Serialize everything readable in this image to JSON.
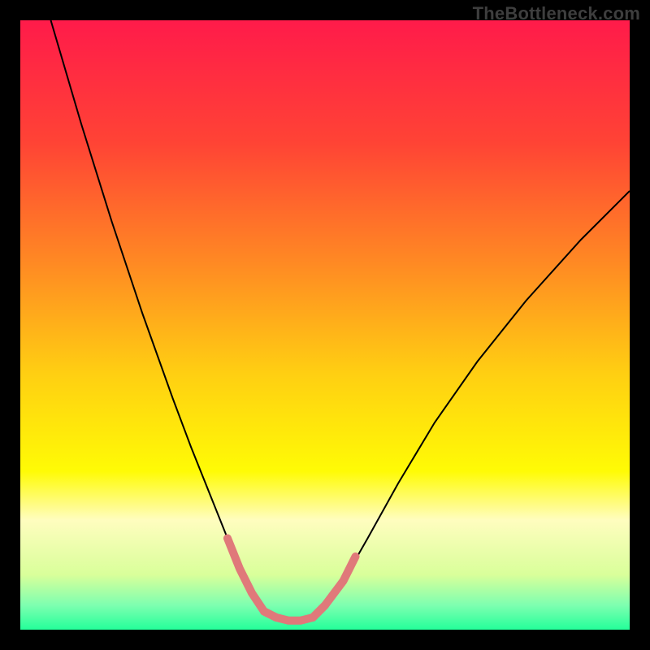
{
  "watermark": "TheBottleneck.com",
  "chart_data": {
    "type": "line",
    "title": "",
    "xlabel": "",
    "ylabel": "",
    "xlim": [
      0,
      100
    ],
    "ylim": [
      0,
      100
    ],
    "grid": false,
    "legend": false,
    "annotations": [],
    "background_gradient_stops": [
      {
        "pct": 0,
        "color": "#ff1b4a"
      },
      {
        "pct": 20,
        "color": "#ff4335"
      },
      {
        "pct": 40,
        "color": "#ff8a23"
      },
      {
        "pct": 58,
        "color": "#ffcf12"
      },
      {
        "pct": 74,
        "color": "#fffb05"
      },
      {
        "pct": 82,
        "color": "#fffdbf"
      },
      {
        "pct": 91,
        "color": "#d9ff9a"
      },
      {
        "pct": 96,
        "color": "#7dffb0"
      },
      {
        "pct": 100,
        "color": "#24ff9a"
      }
    ],
    "series": [
      {
        "name": "left-curve",
        "role": "bottleneck-curve",
        "stroke": "#000000",
        "stroke_width": 2,
        "x": [
          5,
          10,
          15,
          20,
          25,
          28,
          30,
          32,
          34,
          36,
          38,
          40,
          42
        ],
        "y": [
          100,
          83,
          67,
          52,
          38,
          30,
          25,
          20,
          15,
          10,
          6,
          3,
          2
        ]
      },
      {
        "name": "right-curve",
        "role": "bottleneck-curve",
        "stroke": "#000000",
        "stroke_width": 2,
        "x": [
          48,
          50,
          53,
          57,
          62,
          68,
          75,
          83,
          92,
          100
        ],
        "y": [
          2,
          4,
          8,
          15,
          24,
          34,
          44,
          54,
          64,
          72
        ]
      },
      {
        "name": "left-pink-segment",
        "role": "highlight",
        "stroke": "#e0797a",
        "stroke_width": 10,
        "linecap": "round",
        "x": [
          34,
          36,
          38,
          40,
          42
        ],
        "y": [
          15,
          10,
          6,
          3,
          2
        ]
      },
      {
        "name": "bottom-pink-segment",
        "role": "highlight",
        "stroke": "#e0797a",
        "stroke_width": 10,
        "linecap": "round",
        "x": [
          40,
          42,
          44,
          46,
          48,
          50
        ],
        "y": [
          3,
          2,
          1.5,
          1.5,
          2,
          4
        ]
      },
      {
        "name": "right-pink-segment",
        "role": "highlight",
        "stroke": "#e0797a",
        "stroke_width": 10,
        "linecap": "round",
        "x": [
          48,
          50,
          53,
          55
        ],
        "y": [
          2,
          4,
          8,
          12
        ]
      }
    ]
  }
}
